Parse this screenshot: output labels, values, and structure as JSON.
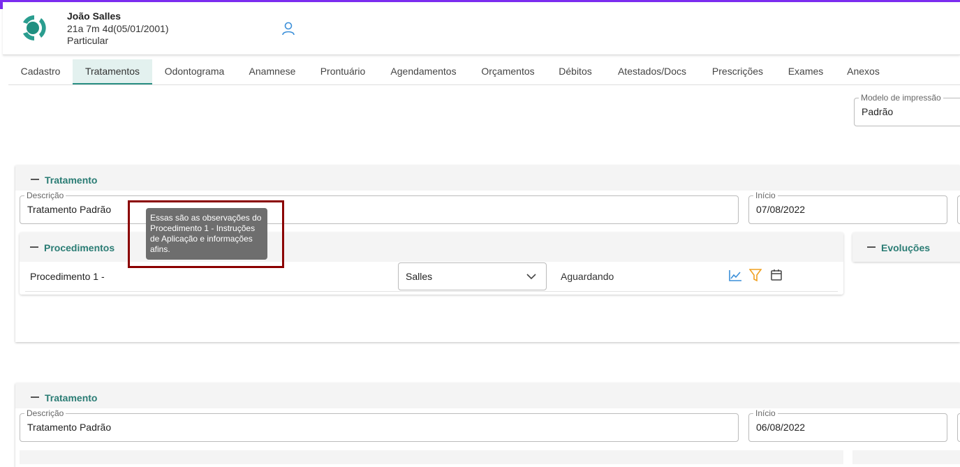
{
  "patient": {
    "name": "João Salles",
    "age": "21a 7m 4d(05/01/2001)",
    "plan": "Particular"
  },
  "tabs": [
    {
      "label": "Cadastro",
      "active": false
    },
    {
      "label": "Tratamentos",
      "active": true
    },
    {
      "label": "Odontograma",
      "active": false
    },
    {
      "label": "Anamnese",
      "active": false
    },
    {
      "label": "Prontuário",
      "active": false
    },
    {
      "label": "Agendamentos",
      "active": false
    },
    {
      "label": "Orçamentos",
      "active": false
    },
    {
      "label": "Débitos",
      "active": false
    },
    {
      "label": "Atestados/Docs",
      "active": false
    },
    {
      "label": "Prescrições",
      "active": false
    },
    {
      "label": "Exames",
      "active": false
    },
    {
      "label": "Anexos",
      "active": false
    }
  ],
  "print_model": {
    "label": "Modelo de impressão",
    "value": "Padrão"
  },
  "treatments": [
    {
      "title": "Tratamento",
      "description_label": "Descrição",
      "description": "Tratamento Padrão",
      "start_label": "Início",
      "start": "07/08/2022",
      "procedures_title": "Procedimentos",
      "evolutions_title": "Evoluções",
      "procedure": {
        "name": "Procedimento 1 -",
        "professional": "Salles",
        "status": "Aguardando"
      }
    },
    {
      "title": "Tratamento",
      "description_label": "Descrição",
      "description": "Tratamento Padrão",
      "start_label": "Início",
      "start": "06/08/2022"
    }
  ],
  "tooltip": {
    "text": "Essas são as observações do Procedimento 1 - Instruções de Aplicação e informações afins."
  },
  "colors": {
    "accent": "#2a7c74",
    "active_tab_bg": "#e3f1ef",
    "tooltip_bg": "#6e6e6e",
    "highlight_border": "#8b0000",
    "icon_blue": "#3b8fd9",
    "icon_orange": "#f0a020"
  }
}
